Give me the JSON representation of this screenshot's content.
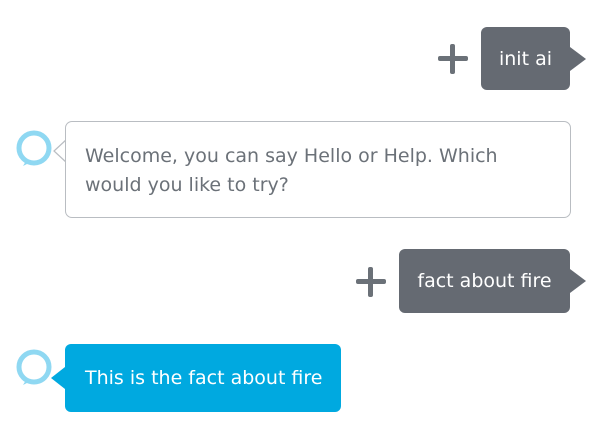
{
  "accent_color": "#00a9e0",
  "user_bubble_color": "#656a72",
  "conversation": [
    {
      "role": "user",
      "text": "init ai",
      "icon": "plus-icon"
    },
    {
      "role": "alexa",
      "text": "Welcome, you can say Hello or Help. Which would you like to try?",
      "icon": "alexa-ring-icon"
    },
    {
      "role": "user",
      "text": "fact about fire",
      "icon": "plus-icon"
    },
    {
      "role": "alexa",
      "text": "This is the fact about fire",
      "icon": "alexa-ring-icon"
    }
  ]
}
